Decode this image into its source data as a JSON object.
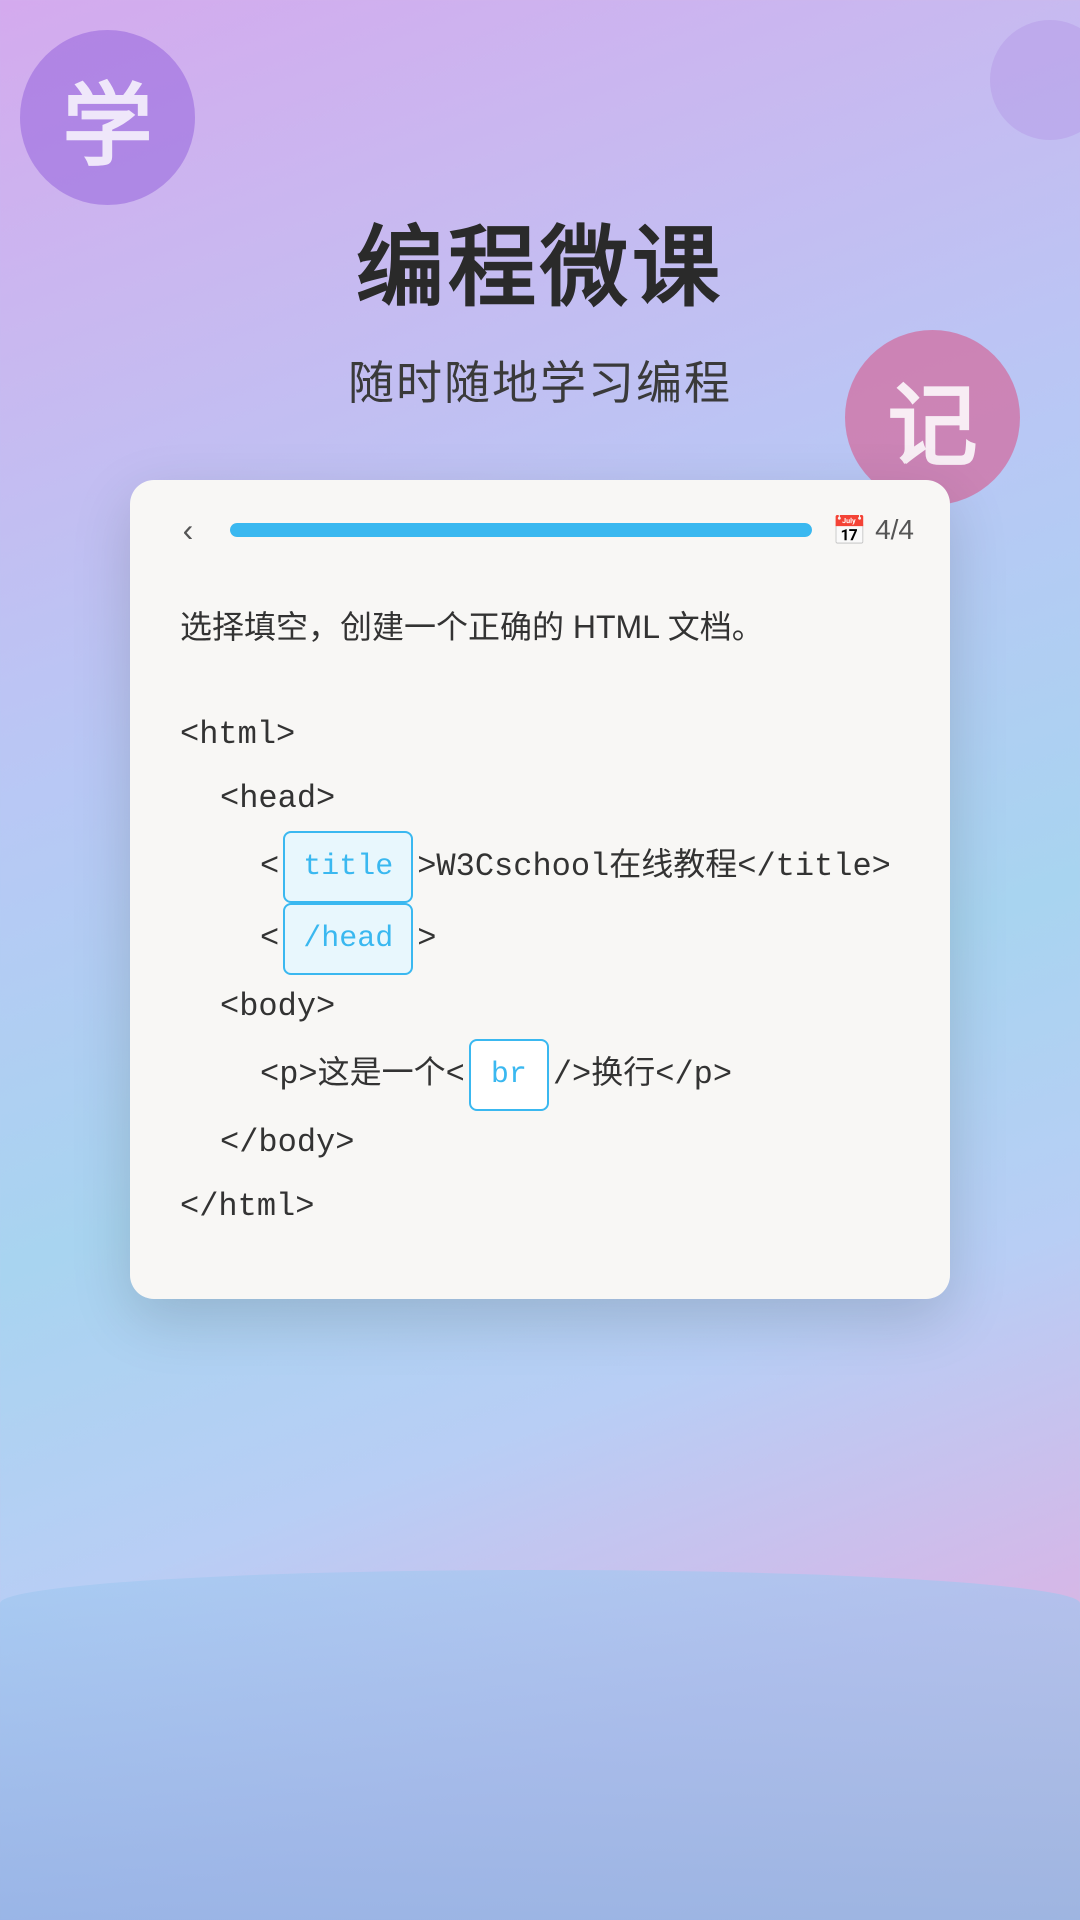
{
  "app": {
    "title": "编程微课",
    "subtitle": "随时随地学习编程"
  },
  "decorative": {
    "circle_left_char": "学",
    "circle_right_char": "记"
  },
  "toolbar": {
    "progress_percent": 100,
    "current_page": "4",
    "total_pages": "4",
    "page_display": "4/4"
  },
  "card": {
    "question": "选择填空，创建一个正确的 HTML 文档。",
    "code_lines": [
      {
        "indent": 0,
        "parts": [
          {
            "type": "text",
            "value": "<html>"
          }
        ]
      },
      {
        "indent": 1,
        "parts": [
          {
            "type": "text",
            "value": "<head>"
          }
        ]
      },
      {
        "indent": 2,
        "parts": [
          {
            "type": "text",
            "value": "<"
          },
          {
            "type": "blank",
            "value": "title",
            "style": "blue"
          },
          {
            "type": "text",
            "value": ">W3Cschool在线教程</title>"
          }
        ]
      },
      {
        "indent": 2,
        "parts": [
          {
            "type": "text",
            "value": "<"
          },
          {
            "type": "blank",
            "value": "/head",
            "style": "blue"
          },
          {
            "type": "text",
            "value": ">"
          }
        ]
      },
      {
        "indent": 1,
        "parts": [
          {
            "type": "text",
            "value": "<body>"
          }
        ]
      },
      {
        "indent": 2,
        "parts": [
          {
            "type": "text",
            "value": "<p>这是一个<"
          },
          {
            "type": "blank",
            "value": "br",
            "style": "normal"
          },
          {
            "type": "text",
            "value": "/>换行</p>"
          }
        ]
      },
      {
        "indent": 1,
        "parts": [
          {
            "type": "text",
            "value": "</body>"
          }
        ]
      },
      {
        "indent": 0,
        "parts": [
          {
            "type": "text",
            "value": "</html>"
          }
        ]
      }
    ]
  },
  "buttons": {
    "back_label": "‹"
  }
}
